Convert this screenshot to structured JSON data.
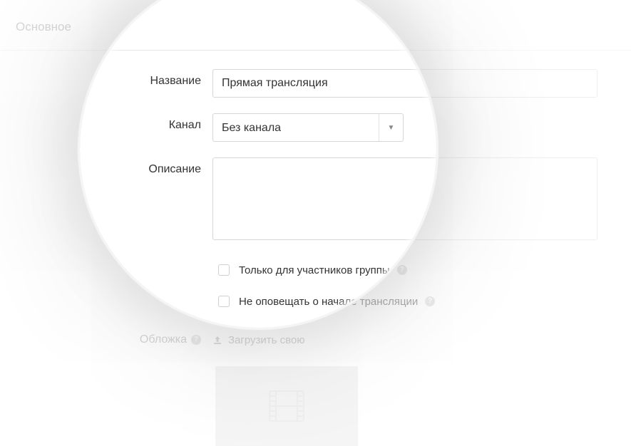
{
  "header": {
    "title": "Основное"
  },
  "form": {
    "name_label": "Название",
    "name_value": "Прямая трансляция",
    "channel_label": "Канал",
    "channel_value": "Без канала",
    "description_label": "Описание",
    "description_value": "",
    "members_only_label": "Только для участников группы",
    "no_notify_label": "Не оповещать о начале трансляции",
    "cover_label": "Обложка",
    "upload_label": "Загрузить свою"
  }
}
